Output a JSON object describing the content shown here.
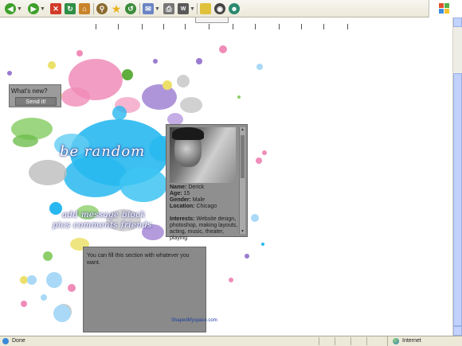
{
  "toolbar": {
    "buttons": [
      {
        "name": "back-button",
        "icon": "back-arrow-icon",
        "color": "#3da02b"
      },
      {
        "name": "forward-button",
        "icon": "forward-arrow-icon",
        "color": "#3da02b"
      },
      {
        "name": "stop-button",
        "icon": "stop-icon",
        "color": "#d13b2a"
      },
      {
        "name": "refresh-button",
        "icon": "refresh-icon",
        "color": "#2f8f46"
      },
      {
        "name": "home-button",
        "icon": "home-icon",
        "color": "#c9842b"
      },
      {
        "name": "search-button",
        "icon": "search-icon",
        "color": "#8a6b2e"
      },
      {
        "name": "favorites-button",
        "icon": "star-icon",
        "color": "#e8b21a"
      },
      {
        "name": "history-button",
        "icon": "history-icon",
        "color": "#3b8c3b"
      },
      {
        "name": "mail-button",
        "icon": "mail-icon",
        "color": "#6b85c6"
      },
      {
        "name": "print-button",
        "icon": "printer-icon",
        "color": "#777777"
      },
      {
        "name": "edit-button",
        "icon": "edit-icon",
        "color": "#5a5a5a"
      },
      {
        "name": "notes-button",
        "icon": "note-icon",
        "color": "#e0c13a"
      },
      {
        "name": "research-button",
        "icon": "research-icon",
        "color": "#444444"
      },
      {
        "name": "messenger-button",
        "icon": "messenger-icon",
        "color": "#2b8a6e"
      }
    ]
  },
  "page": {
    "whats_new": {
      "label": "What's new?",
      "button": "Send it!"
    },
    "title_script": "be random",
    "nav_line1": "add message block",
    "nav_line2": "pics comments friends",
    "profile": {
      "name_label": "Name:",
      "name": "Derick",
      "age_label": "Age:",
      "age": "15",
      "gender_label": "Gender:",
      "gender": "Male",
      "location_label": "Location:",
      "location": "Chicago",
      "interests_label": "Interests:",
      "interests": "Website design, photoshop, making layouts, acting, music, theater, playing"
    },
    "message_text": "You can fill this section with whatever you want.",
    "footer_link": "ShapedMyspace.com"
  },
  "status": {
    "left": "Done",
    "zone": "Internet"
  },
  "colors": {
    "toolbar_bg": "#ece9d8",
    "panel_gray": "#8f8f8f",
    "splat_cyan": "#28b8ef",
    "splat_pink": "#f08cb8",
    "splat_purple": "#9a7ad0",
    "splat_green": "#8ccf6a",
    "splat_yellow": "#ece06a",
    "splat_gray": "#bdbdbd"
  }
}
